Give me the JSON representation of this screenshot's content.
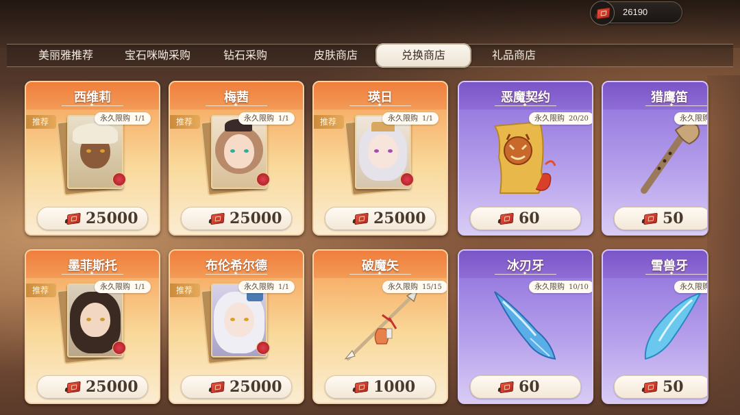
{
  "currency": {
    "value": "26190",
    "icon": "red-ticket-book-icon"
  },
  "tabs": [
    {
      "label": "美丽雅推荐",
      "active": false
    },
    {
      "label": "宝石咪呦采购",
      "active": false
    },
    {
      "label": "钻石采购",
      "active": false
    },
    {
      "label": "皮肤商店",
      "active": false
    },
    {
      "label": "兑换商店",
      "active": true
    },
    {
      "label": "礼品商店",
      "active": false
    }
  ],
  "cards": [
    {
      "name": "西维莉",
      "style": "orange",
      "recommend": "推荐",
      "limit": "永久限购",
      "count": "1/1",
      "price": "25000",
      "art": "portrait-dark-skin-white-hair"
    },
    {
      "name": "梅茜",
      "style": "orange",
      "recommend": "推荐",
      "limit": "永久限购",
      "count": "1/1",
      "price": "25000",
      "art": "portrait-brown-hair-hat"
    },
    {
      "name": "瑛日",
      "style": "orange",
      "recommend": "推荐",
      "limit": "永久限购",
      "count": "1/1",
      "price": "25000",
      "art": "portrait-silver-hair-crown"
    },
    {
      "name": "恶魔契约",
      "style": "purple",
      "recommend": "",
      "limit": "永久限购",
      "count": "20/20",
      "price": "60",
      "art": "demon-contract-scroll-icon"
    },
    {
      "name": "猎鹰笛",
      "style": "purple",
      "recommend": "",
      "limit": "永久限购",
      "count": "",
      "price": "50",
      "art": "falcon-whistle-icon"
    },
    {
      "name": "墨菲斯托",
      "style": "orange",
      "recommend": "推荐",
      "limit": "永久限购",
      "count": "1/1",
      "price": "25000",
      "art": "portrait-dark-hair-glasses"
    },
    {
      "name": "布伦希尔德",
      "style": "orange",
      "recommend": "推荐",
      "limit": "永久限购",
      "count": "1/1",
      "price": "25000",
      "art": "portrait-white-hair-armor"
    },
    {
      "name": "破魔矢",
      "style": "orange",
      "recommend": "",
      "limit": "永久限购",
      "count": "15/15",
      "price": "1000",
      "art": "demon-breaking-arrow-icon"
    },
    {
      "name": "冰刃牙",
      "style": "purple",
      "recommend": "",
      "limit": "永久限购",
      "count": "10/10",
      "price": "60",
      "art": "ice-fang-icon"
    },
    {
      "name": "雪兽牙",
      "style": "purple",
      "recommend": "",
      "limit": "永久限购",
      "count": "",
      "price": "50",
      "art": "snow-beast-fang-icon"
    }
  ]
}
